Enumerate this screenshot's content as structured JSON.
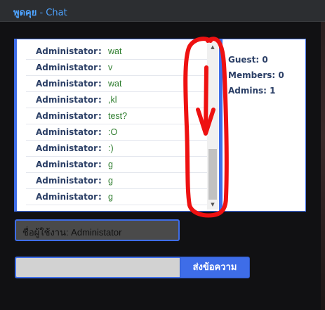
{
  "window": {
    "title_thai": "พูดคุย",
    "title_sep": " - ",
    "title_en": "Chat"
  },
  "messages": [
    {
      "user": "Administator",
      "text": "wat"
    },
    {
      "user": "Administator",
      "text": "v"
    },
    {
      "user": "Administator",
      "text": "wat"
    },
    {
      "user": "Administator",
      "text": ",kl"
    },
    {
      "user": "Administator",
      "text": "test?"
    },
    {
      "user": "Administator",
      "text": ":O"
    },
    {
      "user": "Administator",
      "text": ":)"
    },
    {
      "user": "Administator",
      "text": "g"
    },
    {
      "user": "Administator",
      "text": "g"
    },
    {
      "user": "Administator",
      "text": "g"
    }
  ],
  "stats": {
    "guest": "Guest: 0",
    "members": "Members: 0",
    "admins": "Admins: 1"
  },
  "username_field": {
    "value": "ชื่อผู้ใช้งาน: Administator"
  },
  "message_field": {
    "value": ""
  },
  "send_button": {
    "label": "ส่งข้อความ"
  },
  "colors": {
    "accent": "#3e6de8",
    "username_text": "#2b3f66",
    "message_text": "#2e7d2e",
    "annotation": "#ee1111"
  }
}
